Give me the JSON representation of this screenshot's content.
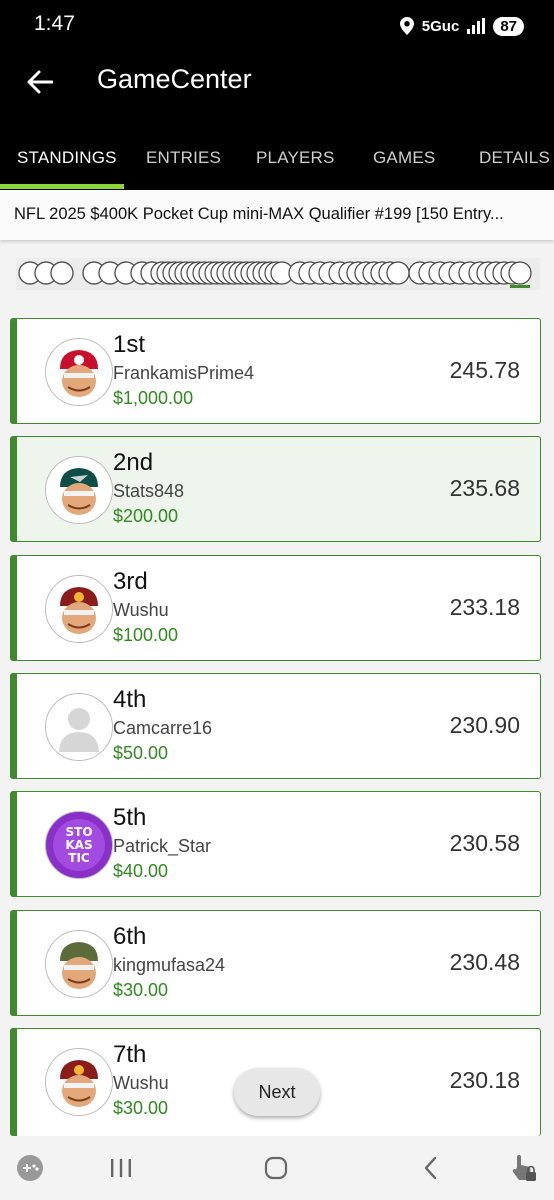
{
  "status": {
    "time": "1:47",
    "network": "5Guc",
    "battery": "87"
  },
  "appbar": {
    "title": "GameCenter"
  },
  "tabs": [
    {
      "label": "STANDINGS"
    },
    {
      "label": "ENTRIES"
    },
    {
      "label": "PLAYERS"
    },
    {
      "label": "GAMES"
    },
    {
      "label": "DETAILS"
    }
  ],
  "contest": {
    "title": "NFL 2025 $400K Pocket Cup mini-MAX Qualifier #199 [150 Entry..."
  },
  "standings": [
    {
      "rank": "1st",
      "user": "FrankamisPrime4",
      "prize": "$1,000.00",
      "score": "245.78",
      "avatar": "helmet-red-icon"
    },
    {
      "rank": "2nd",
      "user": "Stats848",
      "prize": "$200.00",
      "score": "235.68",
      "avatar": "helmet-green-icon"
    },
    {
      "rank": "3rd",
      "user": "Wushu",
      "prize": "$100.00",
      "score": "233.18",
      "avatar": "helmet-burgundy-icon"
    },
    {
      "rank": "4th",
      "user": "Camcarre16",
      "prize": "$50.00",
      "score": "230.90",
      "avatar": "default-user-icon"
    },
    {
      "rank": "5th",
      "user": "Patrick_Star",
      "prize": "$40.00",
      "score": "230.58",
      "avatar": "stokastic-logo-icon",
      "logo_text": "STOKASTIC"
    },
    {
      "rank": "6th",
      "user": "kingmufasa24",
      "prize": "$30.00",
      "score": "230.48",
      "avatar": "helmet-army-icon"
    },
    {
      "rank": "7th",
      "user": "Wushu",
      "prize": "$30.00",
      "score": "230.18",
      "avatar": "helmet-burgundy-icon"
    }
  ],
  "next_button": {
    "label": "Next"
  },
  "colors": {
    "accent": "#8cd63b",
    "card_border": "#3f8a2d",
    "prize": "#2f8a1f"
  }
}
